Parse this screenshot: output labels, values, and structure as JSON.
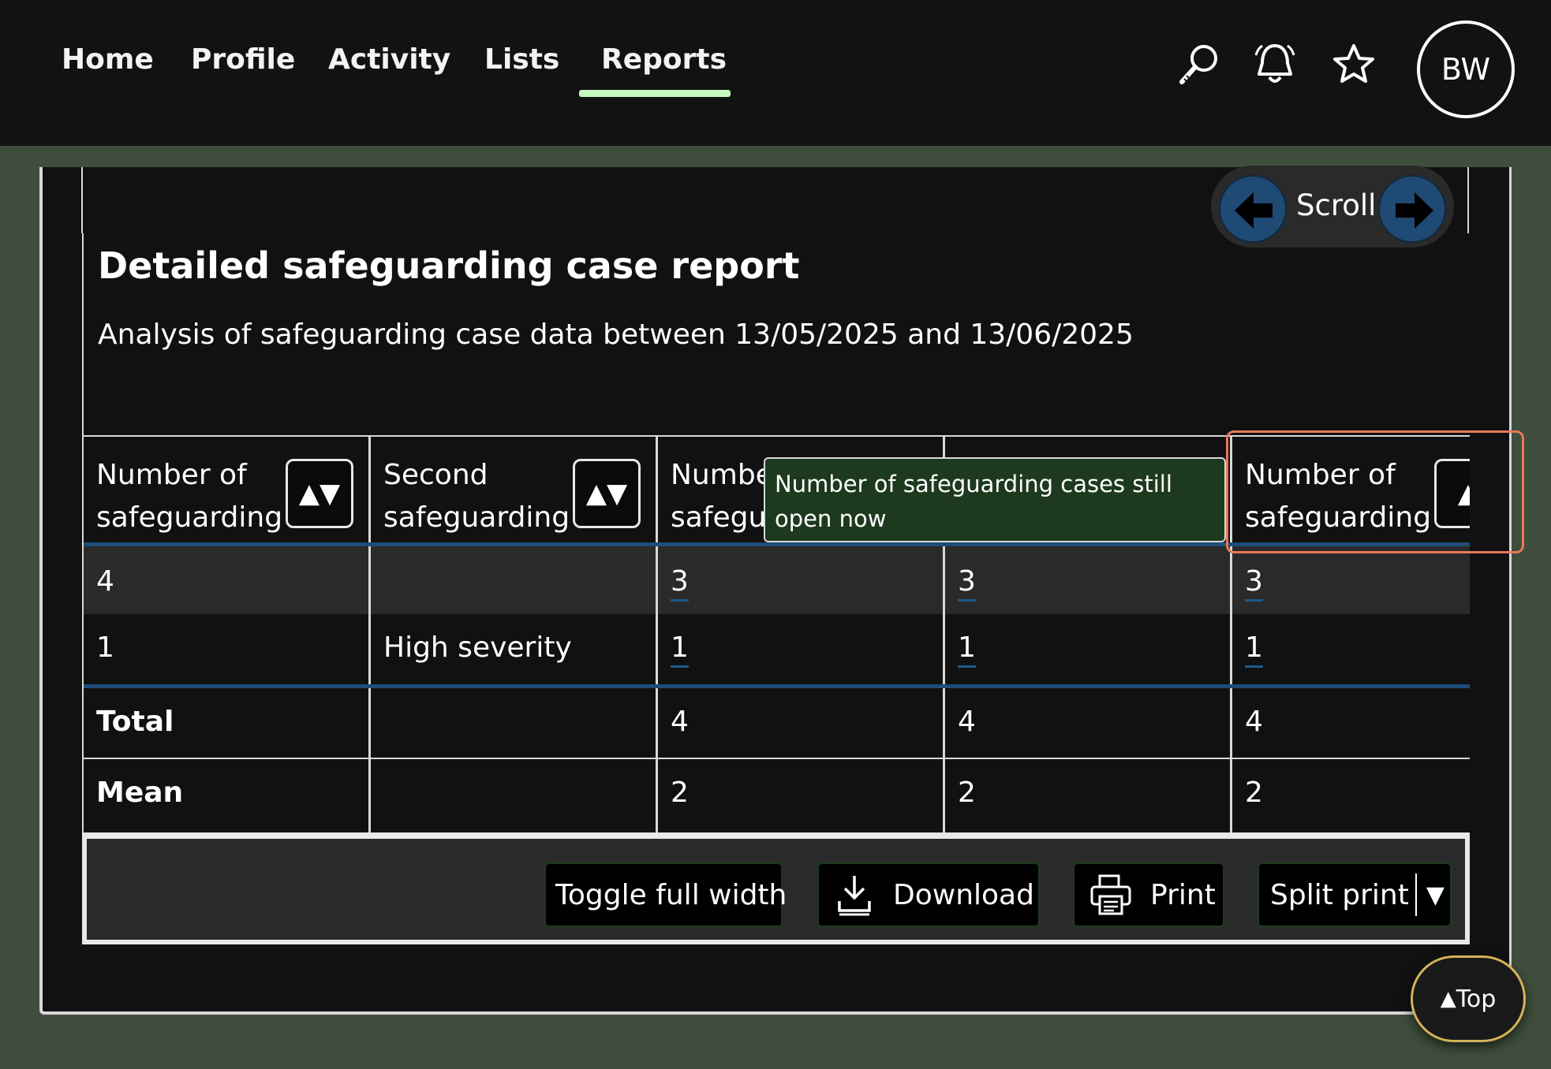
{
  "nav": {
    "items": [
      {
        "label": "Home"
      },
      {
        "label": "Profile"
      },
      {
        "label": "Activity"
      },
      {
        "label": "Lists"
      },
      {
        "label": "Reports"
      }
    ],
    "active": "Reports",
    "icons": [
      "search-icon",
      "bell-icon",
      "star-icon"
    ],
    "avatar_initials": "BW",
    "accent_color": "#c8f7c0"
  },
  "scroll": {
    "label": "Scroll"
  },
  "report": {
    "title": "Detailed safeguarding case report",
    "subtitle": "Analysis of safeguarding case data between 13/05/2025 and 13/06/2025"
  },
  "table": {
    "headers": [
      "Number of safeguarding",
      "Second safeguarding",
      "Numbe safegu",
      "",
      "Number of safeguarding"
    ],
    "rows": [
      [
        "4",
        "",
        "3",
        "3",
        "3"
      ],
      [
        "1",
        "High severity",
        "1",
        "1",
        "1"
      ]
    ],
    "summary": [
      [
        "Total",
        "",
        "4",
        "4",
        "4"
      ],
      [
        "Mean",
        "",
        "2",
        "2",
        "2"
      ]
    ]
  },
  "tooltip": {
    "text": "Number of safeguarding cases still open now"
  },
  "actions": {
    "toggle_full_width": "Toggle full width",
    "download": "Download",
    "print": "Print",
    "split_print": "Split print"
  },
  "top_button": {
    "label": "Top"
  }
}
